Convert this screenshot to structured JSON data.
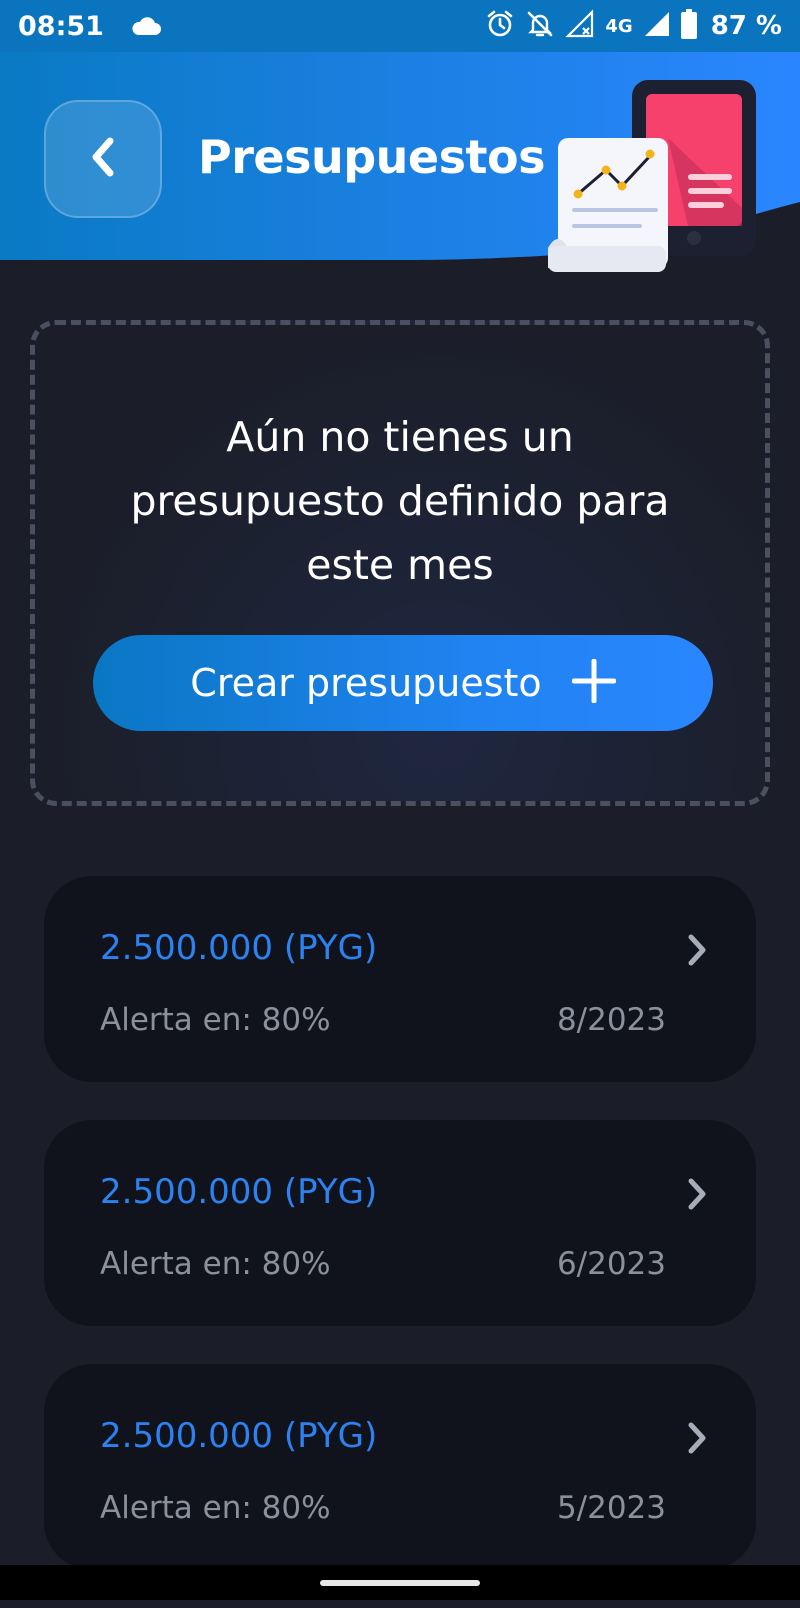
{
  "status_bar": {
    "time": "08:51",
    "network": "4G",
    "battery": "87 %",
    "icons": [
      "cloud-icon",
      "alarm-icon",
      "notifications-off-icon",
      "signal-off-icon",
      "signal-icon",
      "battery-icon"
    ]
  },
  "header": {
    "title": "Presupuestos",
    "back_icon": "chevron-left-icon",
    "illustration": "budget-report-illustration"
  },
  "empty_state": {
    "message": "Aún no tienes un presupuesto definido para este mes",
    "create_button_label": "Crear presupuesto",
    "create_button_icon": "plus-icon"
  },
  "budgets": [
    {
      "amount": "2.500.000 (PYG)",
      "alert": "Alerta en: 80%",
      "date": "8/2023"
    },
    {
      "amount": "2.500.000 (PYG)",
      "alert": "Alerta en: 80%",
      "date": "6/2023"
    },
    {
      "amount": "2.500.000 (PYG)",
      "alert": "Alerta en: 80%",
      "date": "5/2023"
    }
  ],
  "colors": {
    "background": "#1b1e29",
    "header_blue": "#1a7fe0",
    "status_bar": "#0a74bf",
    "accent_blue": "#2b82f0",
    "card_bg": "#10131b",
    "muted_text": "#8c909c"
  }
}
